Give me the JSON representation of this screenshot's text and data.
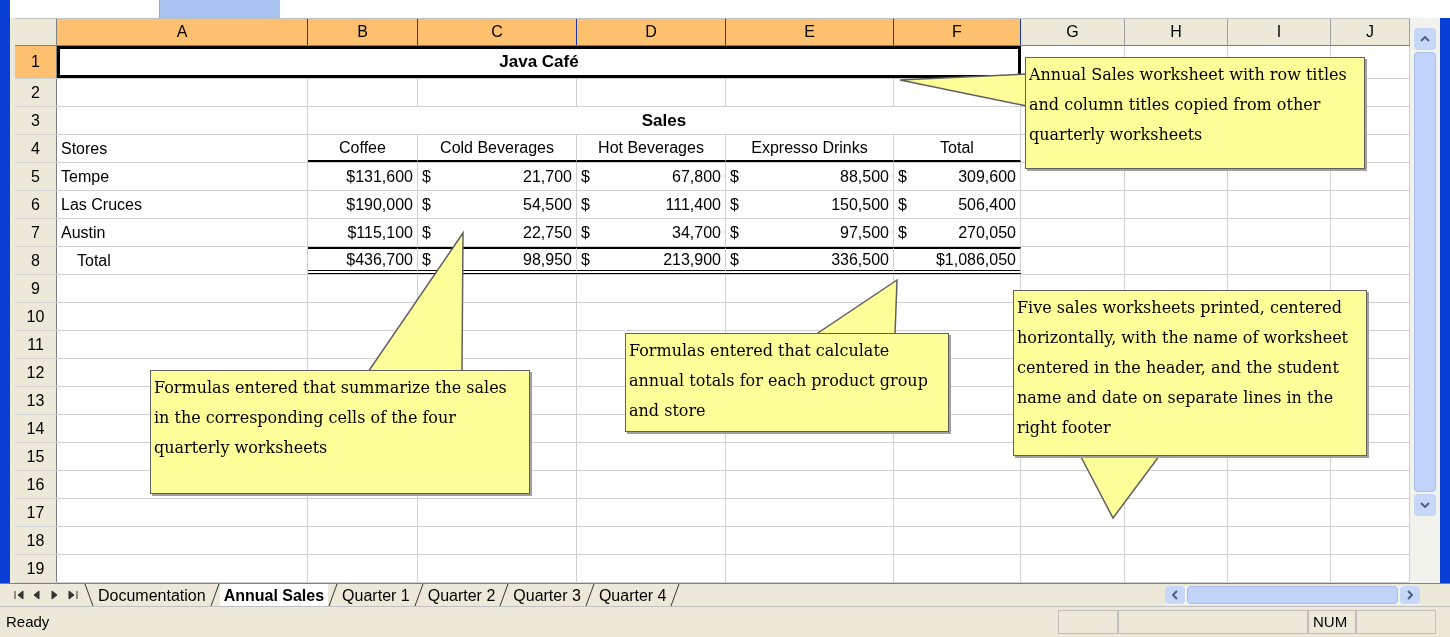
{
  "columns": [
    {
      "label": "A",
      "selected": true
    },
    {
      "label": "B",
      "selected": true
    },
    {
      "label": "C",
      "selected": true
    },
    {
      "label": "D",
      "selected": true
    },
    {
      "label": "E",
      "selected": true
    },
    {
      "label": "F",
      "selected": true
    },
    {
      "label": "G",
      "selected": false
    },
    {
      "label": "H",
      "selected": false
    },
    {
      "label": "I",
      "selected": false
    },
    {
      "label": "J",
      "selected": false
    }
  ],
  "rows": [
    {
      "number": "1",
      "selected": true,
      "kind": "title",
      "text": "Java Café"
    },
    {
      "number": "2",
      "selected": false,
      "kind": "blank"
    },
    {
      "number": "3",
      "selected": false,
      "kind": "section",
      "text": "Sales"
    },
    {
      "number": "4",
      "selected": false,
      "kind": "header",
      "label": "Stores",
      "cells": [
        {
          "value": "Coffee"
        },
        {
          "value": "Cold Beverages"
        },
        {
          "value": "Hot Beverages"
        },
        {
          "value": "Expresso Drinks"
        },
        {
          "value": "Total"
        }
      ]
    },
    {
      "number": "5",
      "selected": false,
      "kind": "data",
      "label": "Tempe",
      "cells": [
        {
          "value": "$131,600"
        },
        {
          "symbol": "$",
          "value": "21,700"
        },
        {
          "symbol": "$",
          "value": "67,800"
        },
        {
          "symbol": "$",
          "value": "88,500"
        },
        {
          "symbol": "$",
          "value": "309,600"
        }
      ]
    },
    {
      "number": "6",
      "selected": false,
      "kind": "data",
      "label": "Las Cruces",
      "cells": [
        {
          "value": "$190,000"
        },
        {
          "symbol": "$",
          "value": "54,500"
        },
        {
          "symbol": "$",
          "value": "111,400"
        },
        {
          "symbol": "$",
          "value": "150,500"
        },
        {
          "symbol": "$",
          "value": "506,400"
        }
      ]
    },
    {
      "number": "7",
      "selected": false,
      "kind": "data",
      "label": "Austin",
      "cells": [
        {
          "value": "$115,100"
        },
        {
          "symbol": "$",
          "value": "22,750"
        },
        {
          "symbol": "$",
          "value": "34,700"
        },
        {
          "symbol": "$",
          "value": "97,500"
        },
        {
          "symbol": "$",
          "value": "270,050"
        }
      ]
    },
    {
      "number": "8",
      "selected": false,
      "kind": "total",
      "label": "Total",
      "cells": [
        {
          "value": "$436,700"
        },
        {
          "symbol": "$",
          "value": "98,950"
        },
        {
          "symbol": "$",
          "value": "213,900"
        },
        {
          "symbol": "$",
          "value": "336,500"
        },
        {
          "value": "$1,086,050"
        }
      ]
    },
    {
      "number": "9",
      "selected": false,
      "kind": "blank"
    },
    {
      "number": "10",
      "selected": false,
      "kind": "blank"
    },
    {
      "number": "11",
      "selected": false,
      "kind": "blank"
    },
    {
      "number": "12",
      "selected": false,
      "kind": "blank"
    },
    {
      "number": "13",
      "selected": false,
      "kind": "blank"
    },
    {
      "number": "14",
      "selected": false,
      "kind": "blank"
    },
    {
      "number": "15",
      "selected": false,
      "kind": "blank"
    },
    {
      "number": "16",
      "selected": false,
      "kind": "blank"
    },
    {
      "number": "17",
      "selected": false,
      "kind": "blank"
    },
    {
      "number": "18",
      "selected": false,
      "kind": "blank"
    },
    {
      "number": "19",
      "selected": false,
      "kind": "blank"
    }
  ],
  "callouts": [
    {
      "text": "Annual Sales worksheet with row titles and column titles copied from other quarterly worksheets"
    },
    {
      "text": "Formulas entered that summarize the sales in the corresponding cells of the four quarterly worksheets"
    },
    {
      "text": "Formulas entered that calculate annual totals for each product group and store"
    },
    {
      "text": "Five sales worksheets printed, centered horizontally, with the name of worksheet centered in the header, and the student name and date on separate lines in the right footer"
    }
  ],
  "sheet_tabs": [
    {
      "label": "Documentation",
      "selected": false
    },
    {
      "label": "Annual Sales",
      "selected": true
    },
    {
      "label": "Quarter 1",
      "selected": false
    },
    {
      "label": "Quarter 2",
      "selected": false
    },
    {
      "label": "Quarter 3",
      "selected": false
    },
    {
      "label": "Quarter 4",
      "selected": false
    }
  ],
  "status_bar": {
    "text": "Ready",
    "indicators": [
      "NUM"
    ]
  }
}
